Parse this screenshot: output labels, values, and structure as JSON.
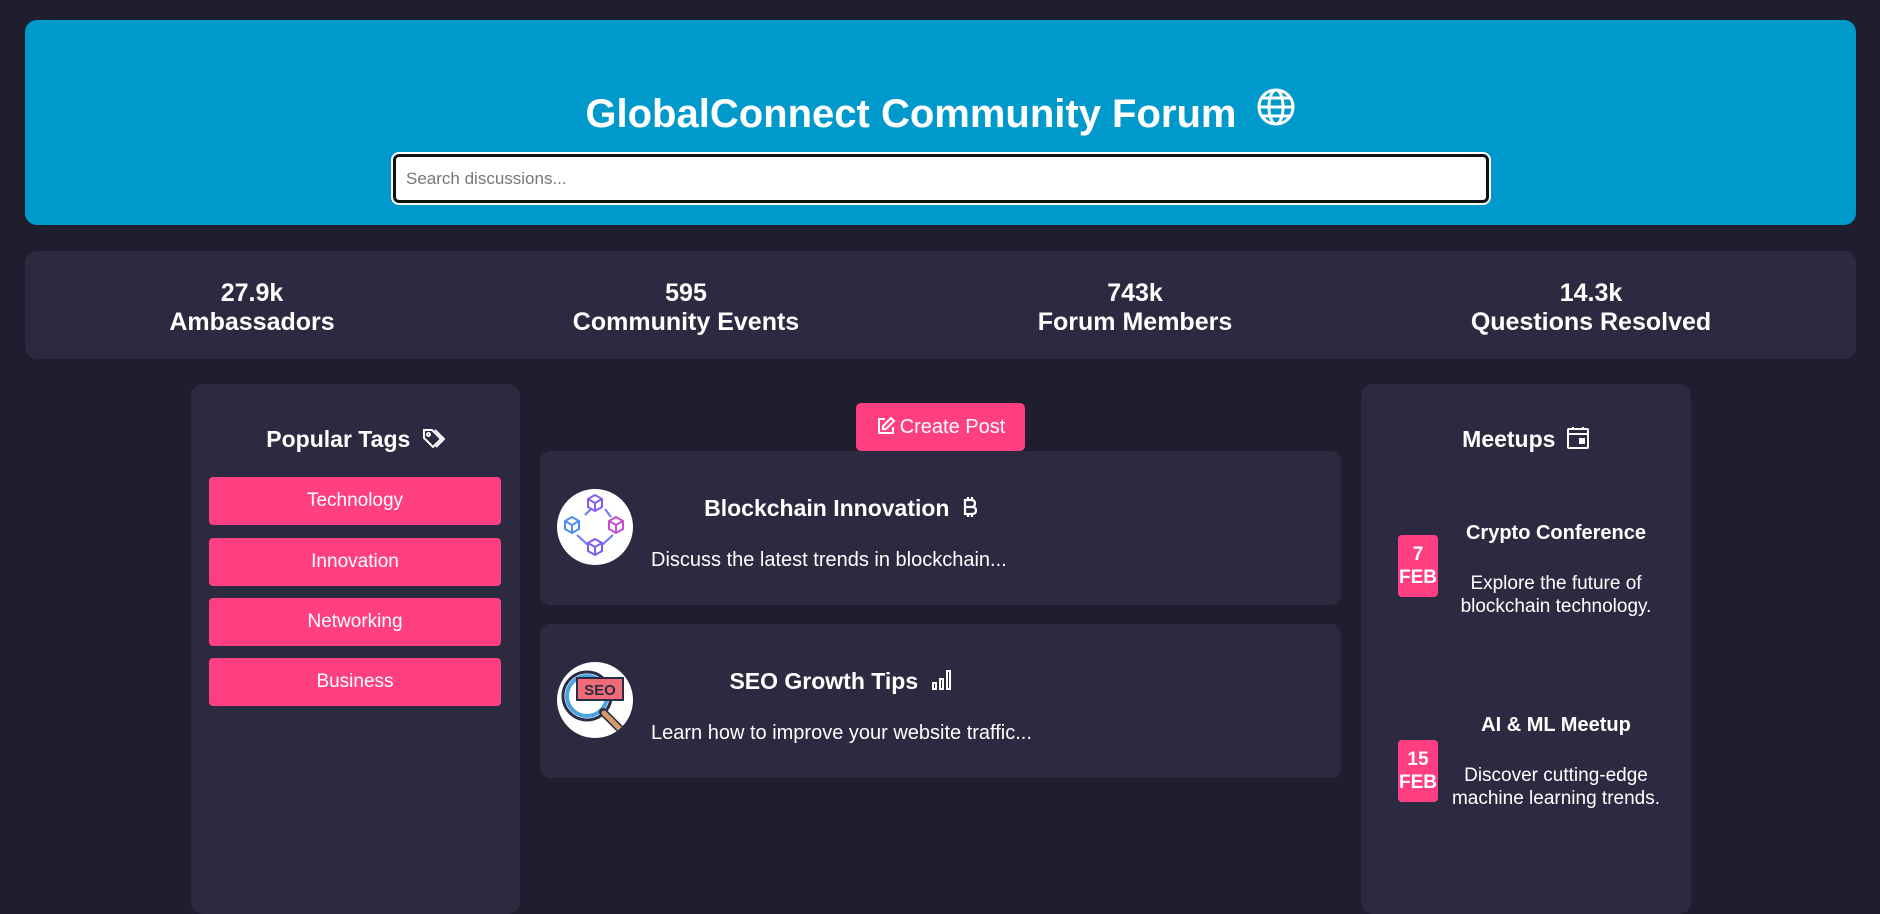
{
  "header": {
    "title": "GlobalConnect Community Forum",
    "title_icon": "globe-icon",
    "search_placeholder": "Search discussions..."
  },
  "stats": [
    {
      "value": "27.9k",
      "label": "Ambassadors"
    },
    {
      "value": "595",
      "label": "Community Events"
    },
    {
      "value": "743k",
      "label": "Forum Members"
    },
    {
      "value": "14.3k",
      "label": "Questions Resolved"
    }
  ],
  "sidebar": {
    "title": "Popular Tags",
    "title_icon": "tags-icon",
    "tags": [
      "Technology",
      "Innovation",
      "Networking",
      "Business"
    ]
  },
  "main": {
    "create_label": "Create Post",
    "create_icon": "edit-icon",
    "posts": [
      {
        "title": "Blockchain Innovation",
        "icon": "bitcoin-icon",
        "avatar": "blockchain-cubes-icon",
        "description": "Discuss the latest trends in blockchain..."
      },
      {
        "title": "SEO Growth Tips",
        "icon": "bar-chart-icon",
        "avatar": "seo-magnifier-icon",
        "avatar_text": "SEO",
        "description": "Learn how to improve your website traffic..."
      }
    ]
  },
  "events": {
    "title": "Meetups",
    "title_icon": "calendar-icon",
    "items": [
      {
        "day": "7",
        "month": "FEB",
        "title": "Crypto Conference",
        "description": "Explore the future of blockchain technology."
      },
      {
        "day": "15",
        "month": "FEB",
        "title": "AI & ML Meetup",
        "description": "Discover cutting-edge machine learning trends."
      }
    ]
  },
  "colors": {
    "background": "#1f1e2f",
    "header": "#0099cc",
    "panel": "#2b2a40",
    "accent": "#ff3f81"
  }
}
